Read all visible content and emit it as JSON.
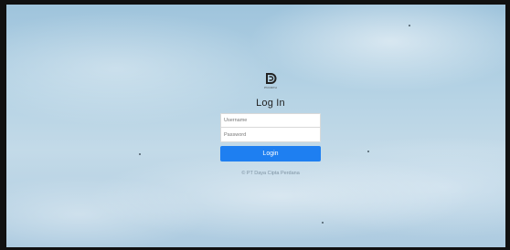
{
  "brand": {
    "logo_icon": "brand-d-logo-icon",
    "logo_text": "PNCDPH",
    "accent_color": "#1e7ff1"
  },
  "login": {
    "title": "Log In",
    "username_placeholder": "Username",
    "password_placeholder": "Password",
    "submit_label": "Login"
  },
  "footer": {
    "copyright": "© PT Daya Cipta Perdana"
  }
}
